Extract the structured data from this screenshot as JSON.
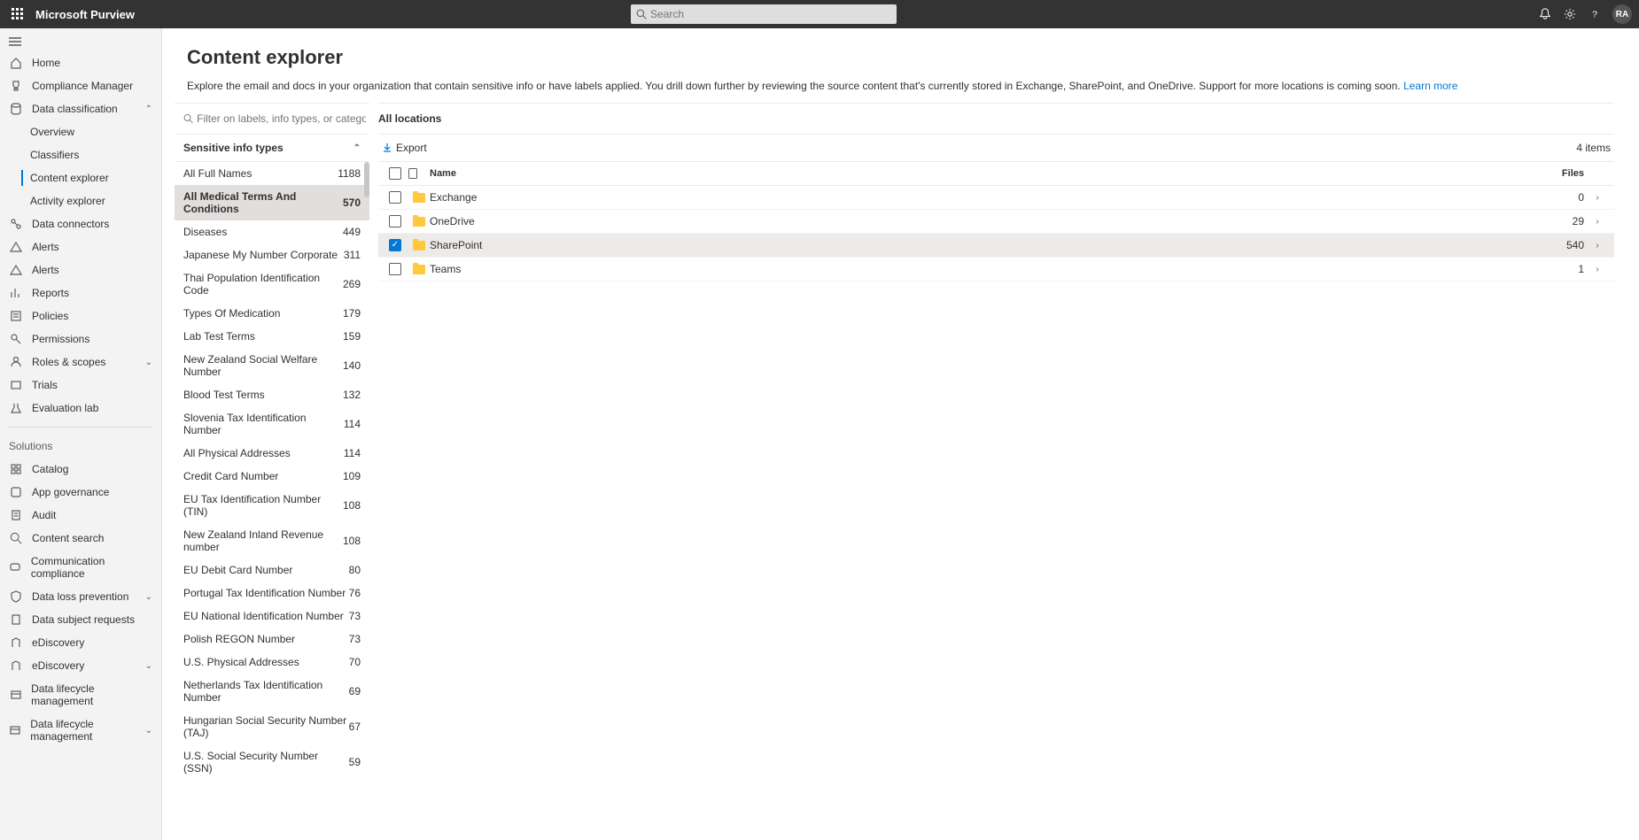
{
  "header": {
    "brand": "Microsoft Purview",
    "search_placeholder": "Search",
    "avatar_initials": "RA"
  },
  "sidebar": {
    "items": [
      {
        "label": "Home",
        "icon": "home"
      },
      {
        "label": "Compliance Manager",
        "icon": "trophy"
      },
      {
        "label": "Data classification",
        "icon": "data",
        "expandable": true,
        "expanded": true
      },
      {
        "label": "Overview",
        "sub": true
      },
      {
        "label": "Classifiers",
        "sub": true
      },
      {
        "label": "Content explorer",
        "sub": true,
        "active": true
      },
      {
        "label": "Activity explorer",
        "sub": true
      },
      {
        "label": "Data connectors",
        "icon": "connector"
      },
      {
        "label": "Alerts",
        "icon": "alert"
      },
      {
        "label": "Alerts",
        "icon": "alert"
      },
      {
        "label": "Reports",
        "icon": "reports"
      },
      {
        "label": "Policies",
        "icon": "policies"
      },
      {
        "label": "Permissions",
        "icon": "permissions"
      },
      {
        "label": "Roles & scopes",
        "icon": "roles",
        "expandable": true
      },
      {
        "label": "Trials",
        "icon": "trials"
      },
      {
        "label": "Evaluation lab",
        "icon": "lab"
      }
    ],
    "solutions_header": "Solutions",
    "solutions": [
      {
        "label": "Catalog",
        "icon": "catalog"
      },
      {
        "label": "App governance",
        "icon": "appgov"
      },
      {
        "label": "Audit",
        "icon": "audit"
      },
      {
        "label": "Content search",
        "icon": "search"
      },
      {
        "label": "Communication compliance",
        "icon": "comm"
      },
      {
        "label": "Data loss prevention",
        "icon": "dlp",
        "expandable": true
      },
      {
        "label": "Data subject requests",
        "icon": "dsr"
      },
      {
        "label": "eDiscovery",
        "icon": "ediscovery"
      },
      {
        "label": "eDiscovery",
        "icon": "ediscovery",
        "expandable": true
      },
      {
        "label": "Data lifecycle management",
        "icon": "dlm"
      },
      {
        "label": "Data lifecycle management",
        "icon": "dlm",
        "expandable": true
      }
    ]
  },
  "page": {
    "title": "Content explorer",
    "description": "Explore the email and docs in your organization that contain sensitive info or have labels applied. You drill down further by reviewing the source content that's currently stored in Exchange, SharePoint, and OneDrive. Support for more locations is coming soon. ",
    "learn_more": "Learn more"
  },
  "filter": {
    "placeholder": "Filter on labels, info types, or categories",
    "group_title": "Sensitive info types",
    "items": [
      {
        "label": "All Full Names",
        "count": 1188
      },
      {
        "label": "All Medical Terms And Conditions",
        "count": 570,
        "selected": true
      },
      {
        "label": "Diseases",
        "count": 449
      },
      {
        "label": "Japanese My Number Corporate",
        "count": 311
      },
      {
        "label": "Thai Population Identification Code",
        "count": 269
      },
      {
        "label": "Types Of Medication",
        "count": 179
      },
      {
        "label": "Lab Test Terms",
        "count": 159
      },
      {
        "label": "New Zealand Social Welfare Number",
        "count": 140
      },
      {
        "label": "Blood Test Terms",
        "count": 132
      },
      {
        "label": "Slovenia Tax Identification Number",
        "count": 114
      },
      {
        "label": "All Physical Addresses",
        "count": 114
      },
      {
        "label": "Credit Card Number",
        "count": 109
      },
      {
        "label": "EU Tax Identification Number (TIN)",
        "count": 108
      },
      {
        "label": "New Zealand Inland Revenue number",
        "count": 108
      },
      {
        "label": "EU Debit Card Number",
        "count": 80
      },
      {
        "label": "Portugal Tax Identification Number",
        "count": 76
      },
      {
        "label": "EU National Identification Number",
        "count": 73
      },
      {
        "label": "Polish REGON Number",
        "count": 73
      },
      {
        "label": "U.S. Physical Addresses",
        "count": 70
      },
      {
        "label": "Netherlands Tax Identification Number",
        "count": 69
      },
      {
        "label": "Hungarian Social Security Number (TAJ)",
        "count": 67
      },
      {
        "label": "U.S. Social Security Number (SSN)",
        "count": 59
      }
    ]
  },
  "locations": {
    "title": "All locations",
    "export_label": "Export",
    "item_count_label": "4 items",
    "columns": {
      "name": "Name",
      "files": "Files"
    },
    "rows": [
      {
        "name": "Exchange",
        "files": 0
      },
      {
        "name": "OneDrive",
        "files": 29
      },
      {
        "name": "SharePoint",
        "files": 540,
        "selected": true
      },
      {
        "name": "Teams",
        "files": 1
      }
    ]
  }
}
